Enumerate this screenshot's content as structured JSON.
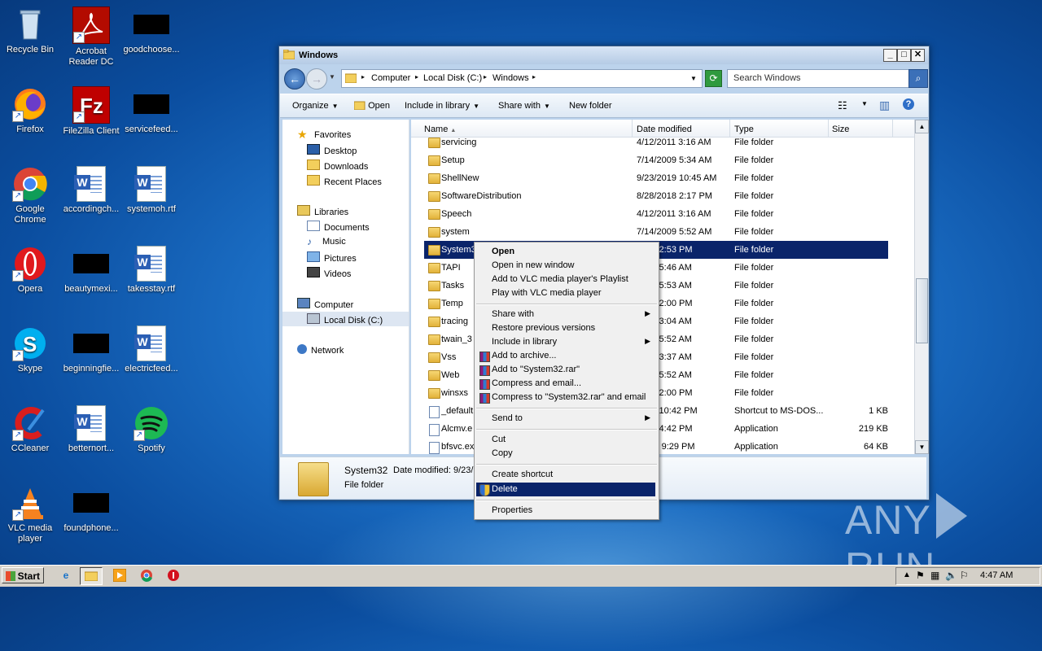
{
  "desktop": {
    "icons": [
      {
        "label": "Recycle Bin"
      },
      {
        "label": "Acrobat Reader DC"
      },
      {
        "label": "goodchoose..."
      },
      {
        "label": "Firefox"
      },
      {
        "label": "FileZilla Client"
      },
      {
        "label": "servicefeed..."
      },
      {
        "label": "Google Chrome"
      },
      {
        "label": "accordingch..."
      },
      {
        "label": "systemoh.rtf"
      },
      {
        "label": "Opera"
      },
      {
        "label": "beautymexi..."
      },
      {
        "label": "takesstay.rtf"
      },
      {
        "label": "Skype"
      },
      {
        "label": "beginningfie..."
      },
      {
        "label": "electricfeed..."
      },
      {
        "label": "CCleaner"
      },
      {
        "label": "betternort..."
      },
      {
        "label": "Spotify"
      },
      {
        "label": "VLC media player"
      },
      {
        "label": "foundphone..."
      }
    ]
  },
  "window": {
    "title": "Windows",
    "controls": {
      "minimize": "_",
      "maximize": "□",
      "close": "✕"
    },
    "address": {
      "crumbs": [
        "Computer",
        "Local Disk (C:)",
        "Windows"
      ]
    },
    "search": {
      "placeholder": "Search Windows"
    },
    "toolbar": {
      "organize": "Organize",
      "open": "Open",
      "include": "Include in library",
      "share": "Share with",
      "new_folder": "New folder"
    },
    "nav": {
      "favorites": "Favorites",
      "desktop": "Desktop",
      "downloads": "Downloads",
      "recent": "Recent Places",
      "libraries": "Libraries",
      "documents": "Documents",
      "music": "Music",
      "pictures": "Pictures",
      "videos": "Videos",
      "computer": "Computer",
      "local_disk": "Local Disk (C:)",
      "network": "Network"
    },
    "columns": {
      "name": "Name",
      "date": "Date modified",
      "type": "Type",
      "size": "Size"
    },
    "rows": [
      {
        "name": "servicing",
        "date": "4/12/2011 3:16 AM",
        "type": "File folder",
        "size": ""
      },
      {
        "name": "Setup",
        "date": "7/14/2009 5:34 AM",
        "type": "File folder",
        "size": ""
      },
      {
        "name": "ShellNew",
        "date": "9/23/2019 10:45 AM",
        "type": "File folder",
        "size": ""
      },
      {
        "name": "SoftwareDistribution",
        "date": "8/28/2018 2:17 PM",
        "type": "File folder",
        "size": ""
      },
      {
        "name": "Speech",
        "date": "4/12/2011 3:16 AM",
        "type": "File folder",
        "size": ""
      },
      {
        "name": "system",
        "date": "7/14/2009 5:52 AM",
        "type": "File folder",
        "size": ""
      },
      {
        "name": "System3",
        "date": "2019 2:53 PM",
        "type": "File folder",
        "size": ""
      },
      {
        "name": "TAPI",
        "date": "2009 5:46 AM",
        "type": "File folder",
        "size": ""
      },
      {
        "name": "Tasks",
        "date": "2009 5:53 AM",
        "type": "File folder",
        "size": ""
      },
      {
        "name": "Temp",
        "date": "2019 2:00 PM",
        "type": "File folder",
        "size": ""
      },
      {
        "name": "tracing",
        "date": "2009 3:04 AM",
        "type": "File folder",
        "size": ""
      },
      {
        "name": "twain_3",
        "date": "2009 5:52 AM",
        "type": "File folder",
        "size": ""
      },
      {
        "name": "Vss",
        "date": "2009 3:37 AM",
        "type": "File folder",
        "size": ""
      },
      {
        "name": "Web",
        "date": "2009 5:52 AM",
        "type": "File folder",
        "size": ""
      },
      {
        "name": "winsxs",
        "date": "2019 2:00 PM",
        "type": "File folder",
        "size": ""
      },
      {
        "name": "_default",
        "date": "2009 10:42 PM",
        "type": "Shortcut to MS-DOS...",
        "size": "1 KB"
      },
      {
        "name": "Alcmv.e",
        "date": "2009 4:42 PM",
        "type": "Application",
        "size": "219 KB"
      },
      {
        "name": "bfsvc.ex",
        "date": "/2010 9:29 PM",
        "type": "Application",
        "size": "64 KB"
      }
    ],
    "details": {
      "name": "System32",
      "date_label": "Date modified: 9/23/",
      "type": "File folder"
    }
  },
  "context_menu": {
    "open": "Open",
    "open_new": "Open in new window",
    "vlc_playlist": "Add to VLC media player's Playlist",
    "vlc_play": "Play with VLC media player",
    "share": "Share with",
    "restore": "Restore previous versions",
    "include": "Include in library",
    "add_archive": "Add to archive...",
    "add_rar": "Add to \"System32.rar\"",
    "compress_email": "Compress and email...",
    "compress_rar_email": "Compress to \"System32.rar\" and email",
    "send_to": "Send to",
    "cut": "Cut",
    "copy": "Copy",
    "create_shortcut": "Create shortcut",
    "delete": "Delete",
    "properties": "Properties"
  },
  "taskbar": {
    "start": "Start",
    "clock": "4:47 AM"
  },
  "watermark": {
    "left": "ANY",
    "right": "RUN"
  }
}
